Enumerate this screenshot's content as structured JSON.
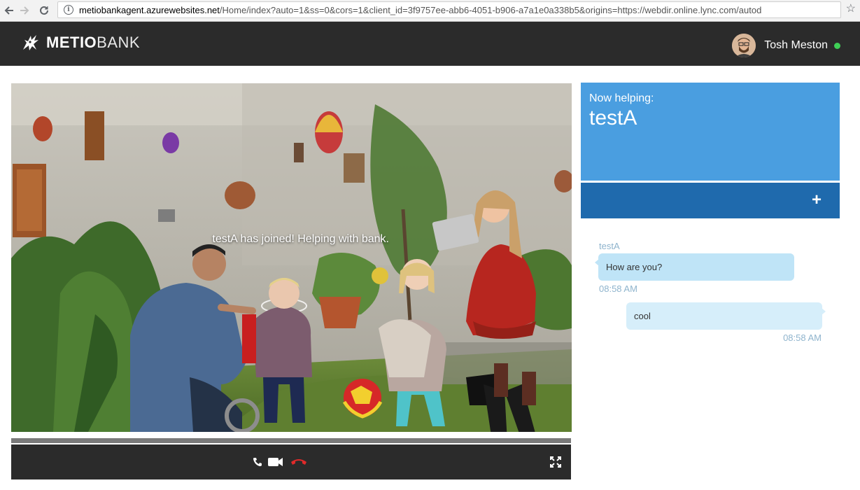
{
  "browser": {
    "url_host": "metiobankagent.azurewebsites.net",
    "url_rest": "/Home/index?auto=1&ss=0&cors=1&client_id=3f9757ee-abb6-4051-b906-a7a1e0a338b5&origins=https://webdir.online.lync.com/autod",
    "icons": {
      "back": "arrow-left-icon",
      "forward": "arrow-right-icon",
      "reload": "reload-icon",
      "info": "info-icon",
      "bookmark": "star-icon"
    }
  },
  "header": {
    "brand_bold": "METIO",
    "brand_light": "BANK",
    "user_name": "Tosh Meston",
    "status_color": "#3fcf56"
  },
  "video": {
    "overlay": "testA has joined! Helping with bank.",
    "controls": {
      "audio": "phone-icon",
      "video": "video-camera-icon",
      "hangup": "hang-up-icon",
      "fullscreen": "fullscreen-icon"
    }
  },
  "panel": {
    "now_helping_label": "Now helping:",
    "customer_name": "testA",
    "add_label": "+"
  },
  "chat": {
    "messages": [
      {
        "sender": "testA",
        "text": "How are you?",
        "time": "08:58 AM"
      },
      {
        "sender": "",
        "text": "cool",
        "time": "08:58 AM"
      }
    ]
  },
  "colors": {
    "header_bg": "#2b2b2b",
    "helping_card": "#4a9ee0",
    "action_bar": "#1f6aad",
    "incoming_bubble": "#bfe4f7",
    "outgoing_bubble": "#d6eefa",
    "hangup_red": "#e02a2a"
  }
}
